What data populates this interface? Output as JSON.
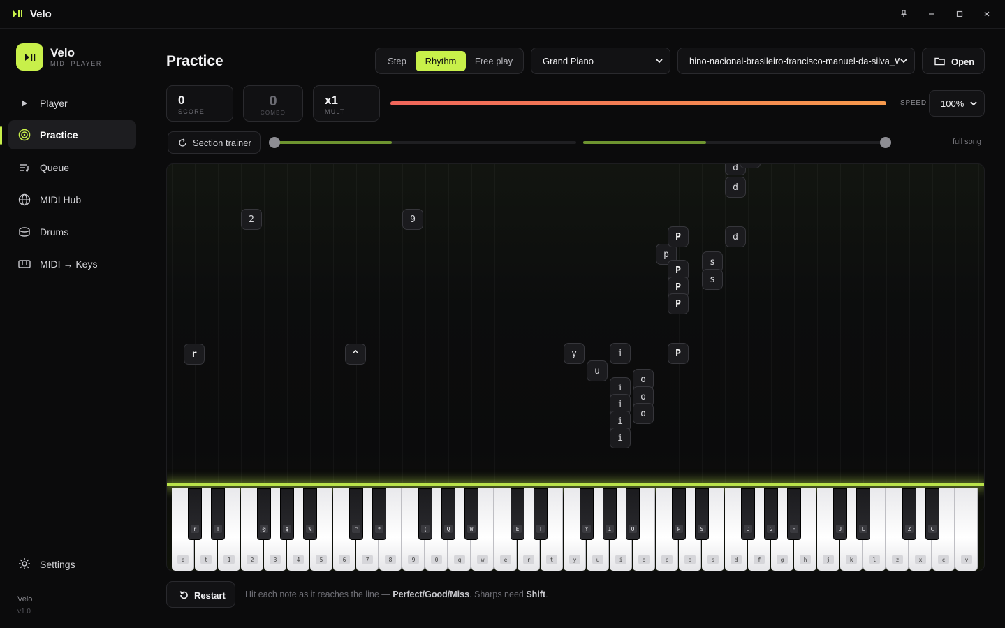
{
  "window": {
    "title": "Velo",
    "controls": [
      "pin-icon",
      "minimize-icon",
      "maximize-icon",
      "close-icon"
    ]
  },
  "brand": {
    "name": "Velo",
    "subtitle": "MIDI PLAYER",
    "accent": "#c8f04a"
  },
  "sidebar": {
    "items": [
      {
        "label": "Player",
        "icon": "play-icon",
        "active": false
      },
      {
        "label": "Practice",
        "icon": "target-icon",
        "active": true
      },
      {
        "label": "Queue",
        "icon": "queue-icon",
        "active": false
      },
      {
        "label": "MIDI Hub",
        "icon": "globe-icon",
        "active": false
      },
      {
        "label": "Drums",
        "icon": "drum-icon",
        "active": false
      },
      {
        "label": "MIDI → Keys",
        "icon": "keyboard-icon",
        "active": false
      }
    ],
    "settings_label": "Settings",
    "footer_name": "Velo",
    "footer_version": "v1.0"
  },
  "header": {
    "title": "Practice",
    "modes": [
      {
        "label": "Step",
        "active": false
      },
      {
        "label": "Rhythm",
        "active": true
      },
      {
        "label": "Free play",
        "active": false
      }
    ],
    "instrument": "Grand Piano",
    "song": "hino-nacional-brasileiro-francisco-manuel-da-silva_W",
    "open_label": "Open"
  },
  "stats": {
    "score_value": "0",
    "score_label": "SCORE",
    "combo_value": "0",
    "combo_label": "COMBO",
    "mult_value": "x1",
    "mult_label": "MULT"
  },
  "progress": {
    "fraction": 1.0
  },
  "speed": {
    "label": "SPEED",
    "value": "100%"
  },
  "section": {
    "trainer_label": "Section trainer",
    "start_fraction": 0.0,
    "end_fraction": 1.0,
    "range_label": "full song"
  },
  "notes": [
    {
      "key": "2"
    },
    {
      "key": "9"
    },
    {
      "key": "r"
    },
    {
      "key": "^"
    },
    {
      "key": "d"
    },
    {
      "key": "d"
    },
    {
      "key": "d"
    },
    {
      "key": "P"
    },
    {
      "key": "p"
    },
    {
      "key": "P"
    },
    {
      "key": "P"
    },
    {
      "key": "P"
    },
    {
      "key": "s"
    },
    {
      "key": "s"
    },
    {
      "key": "y"
    },
    {
      "key": "u"
    },
    {
      "key": "i"
    },
    {
      "key": "i"
    },
    {
      "key": "i"
    },
    {
      "key": "i"
    },
    {
      "key": "i"
    },
    {
      "key": "o"
    },
    {
      "key": "o"
    },
    {
      "key": "o"
    },
    {
      "key": "P"
    }
  ],
  "keyboard": {
    "white_keys": [
      "e",
      "t",
      "1",
      "2",
      "3",
      "4",
      "5",
      "6",
      "7",
      "8",
      "9",
      "0",
      "q",
      "w",
      "e",
      "r",
      "t",
      "y",
      "u",
      "i",
      "o",
      "p",
      "a",
      "s",
      "d",
      "f",
      "g",
      "h",
      "j",
      "k",
      "l",
      "z",
      "x",
      "c",
      "v"
    ],
    "black_keys": [
      "r",
      "!",
      "@",
      "$",
      "%",
      "^",
      "*",
      "(",
      "Q",
      "W",
      "E",
      "T",
      "Y",
      "I",
      "O",
      "P",
      "S",
      "D",
      "G",
      "H",
      "J",
      "L",
      "Z",
      "C"
    ]
  },
  "footer": {
    "restart_label": "Restart",
    "hint_prefix": "Hit each note as it reaches the line — ",
    "hint_perfect": "Perfect",
    "hint_sep1": "/",
    "hint_good": "Good",
    "hint_sep2": "/",
    "hint_miss": "Miss",
    "hint_mid": ". Sharps need ",
    "hint_shift": "Shift",
    "hint_end": "."
  }
}
